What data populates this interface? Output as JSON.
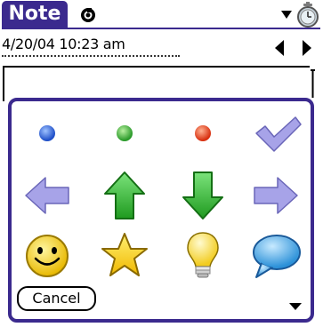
{
  "title": {
    "app_label": "Note"
  },
  "header": {
    "info_icon": "info-icon",
    "category_icon": "chevron-down-icon",
    "alarm_icon": "alarm-clock-icon"
  },
  "note": {
    "timestamp": "4/20/04 10:23 am",
    "prev_icon": "triangle-left-icon",
    "next_icon": "triangle-right-icon"
  },
  "picker": {
    "icons": [
      {
        "name": "blue-dot-icon"
      },
      {
        "name": "green-dot-icon"
      },
      {
        "name": "red-dot-icon"
      },
      {
        "name": "checkmark-icon"
      },
      {
        "name": "arrow-left-icon"
      },
      {
        "name": "arrow-up-icon"
      },
      {
        "name": "arrow-down-icon"
      },
      {
        "name": "arrow-right-icon"
      },
      {
        "name": "smiley-icon"
      },
      {
        "name": "star-icon"
      },
      {
        "name": "lightbulb-icon"
      },
      {
        "name": "speech-bubble-icon"
      }
    ],
    "cancel_label": "Cancel",
    "scroll_icon": "scroll-down-icon"
  },
  "colors": {
    "accent": "#3b2a8e",
    "blue_dot": "#2f63e0",
    "green_dot": "#33b033",
    "red_dot": "#e04020",
    "lavender": "#a7a3e8",
    "green_arrow": "#2cb32c",
    "yellow": "#f6d81a"
  }
}
